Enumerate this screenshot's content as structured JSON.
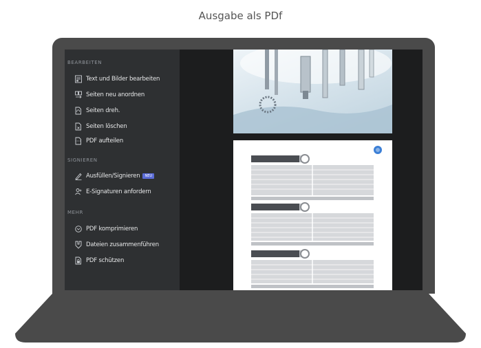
{
  "caption": "Ausgabe als PDf",
  "sidebar": {
    "sections": [
      {
        "title": "BEARBEITEN"
      },
      {
        "title": "SIGNIEREN"
      },
      {
        "title": "MEHR"
      }
    ],
    "items": [
      {
        "label": "Text und Bilder bearbeiten",
        "icon": "edit-text-icon"
      },
      {
        "label": "Seiten neu anordnen",
        "icon": "reorder-pages-icon"
      },
      {
        "label": "Seiten dreh.",
        "icon": "rotate-page-icon"
      },
      {
        "label": "Seiten löschen",
        "icon": "delete-page-icon"
      },
      {
        "label": "PDF aufteilen",
        "icon": "split-pdf-icon"
      },
      {
        "label": "Ausfüllen/Signieren",
        "icon": "fill-sign-icon",
        "badge": "NEU"
      },
      {
        "label": "E-Signaturen anfordern",
        "icon": "request-signature-icon"
      },
      {
        "label": "PDF komprimieren",
        "icon": "compress-pdf-icon"
      },
      {
        "label": "Dateien zusammenführen",
        "icon": "merge-files-icon"
      },
      {
        "label": "PDF schützen",
        "icon": "protect-pdf-icon"
      }
    ]
  },
  "colors": {
    "laptop_body": "#4a4a4a",
    "sidebar_bg": "#2e3032",
    "viewer_bg": "#1c1d1e",
    "badge_bg": "#5a6bd6",
    "document_accent": "#3b7fd6"
  }
}
